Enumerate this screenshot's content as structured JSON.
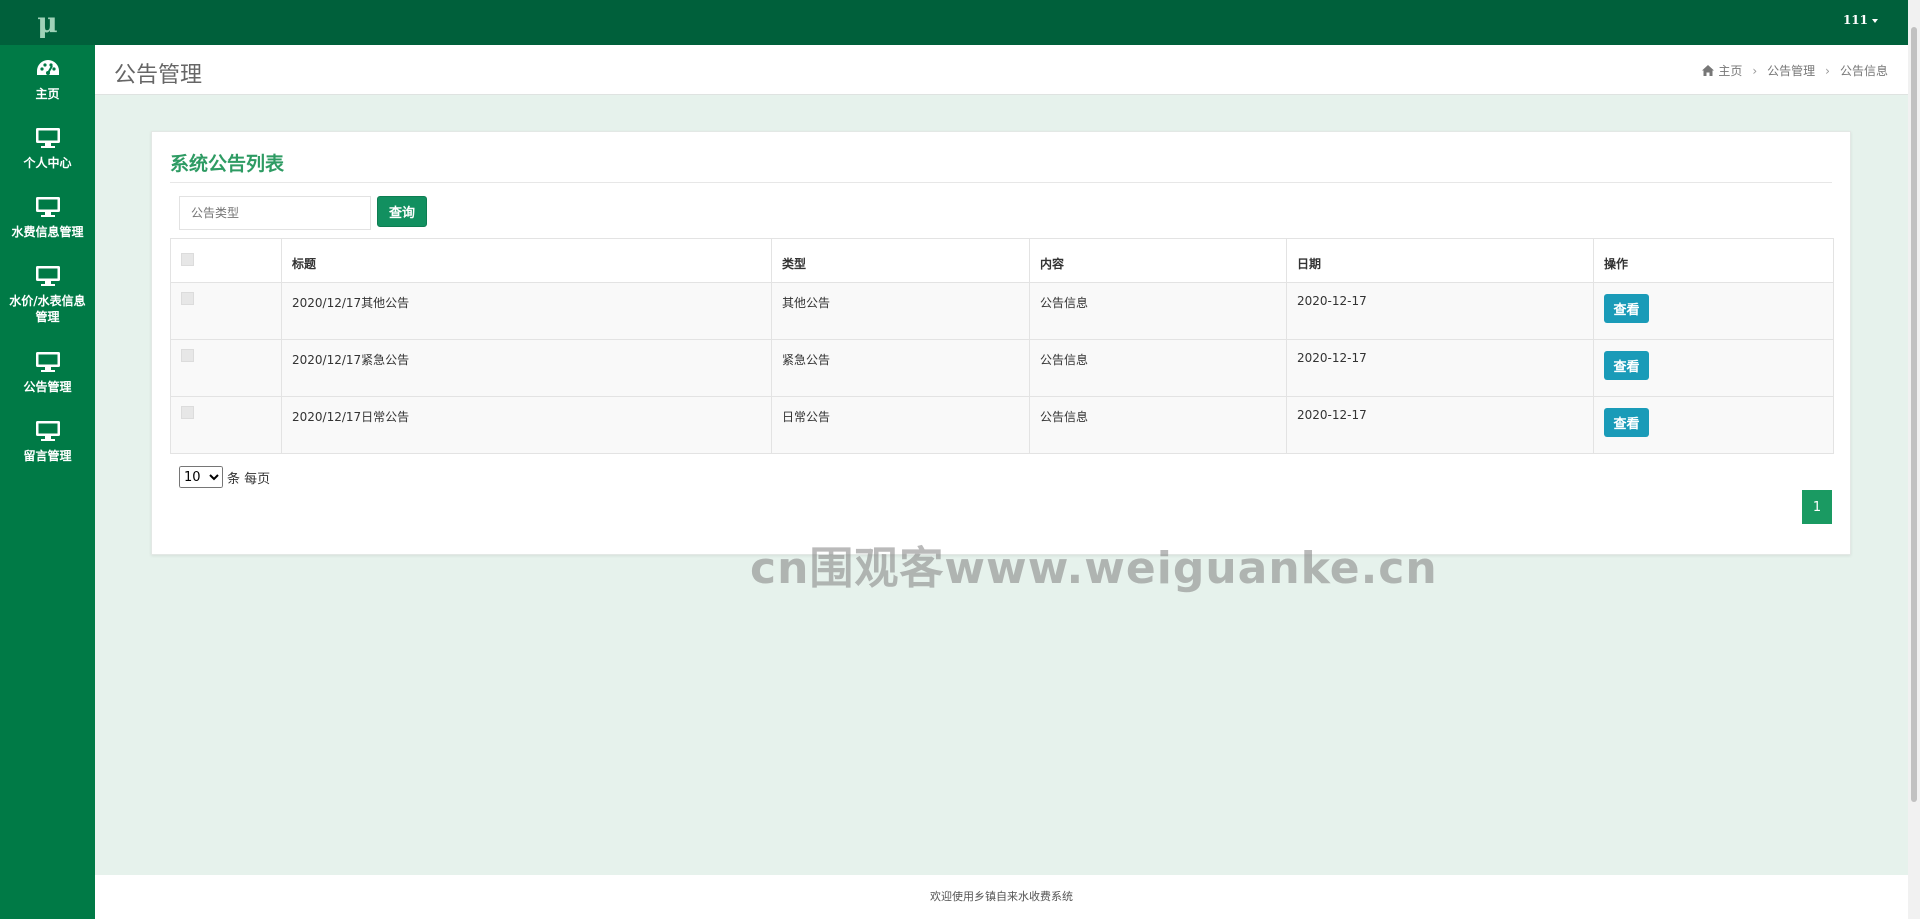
{
  "app": {
    "logo": "μ"
  },
  "sidebar": {
    "items": [
      {
        "label": "主页",
        "icon": "dashboard-icon"
      },
      {
        "label": "个人中心",
        "icon": "monitor-icon"
      },
      {
        "label": "水费信息管理",
        "icon": "monitor-icon"
      },
      {
        "label": "水价/水表信息管理",
        "icon": "monitor-icon"
      },
      {
        "label": "公告管理",
        "icon": "monitor-icon"
      },
      {
        "label": "留言管理",
        "icon": "monitor-icon"
      }
    ]
  },
  "topbar": {
    "user": "111"
  },
  "header": {
    "title": "公告管理",
    "breadcrumb": [
      "主页",
      "公告管理",
      "公告信息"
    ]
  },
  "panel": {
    "title": "系统公告列表",
    "search": {
      "placeholder": "公告类型",
      "button": "查询"
    },
    "columns": [
      "标题",
      "类型",
      "内容",
      "日期",
      "操作"
    ],
    "rows": [
      {
        "title": "2020/12/17其他公告",
        "type": "其他公告",
        "content": "公告信息",
        "date": "2020-12-17",
        "action": "查看"
      },
      {
        "title": "2020/12/17紧急公告",
        "type": "紧急公告",
        "content": "公告信息",
        "date": "2020-12-17",
        "action": "查看"
      },
      {
        "title": "2020/12/17日常公告",
        "type": "日常公告",
        "content": "公告信息",
        "date": "2020-12-17",
        "action": "查看"
      }
    ],
    "page_size": {
      "value": "10",
      "suffix": "条 每页"
    },
    "pagination": {
      "current": "1"
    }
  },
  "watermark": "cn围观客www.weiguanke.cn",
  "footer": {
    "text": "欢迎使用乡镇自来水收费系统"
  },
  "colors": {
    "sidebar": "#007a46",
    "topbar": "#00603b",
    "accent": "#2e9b63",
    "view_button": "#1a9bb8"
  }
}
